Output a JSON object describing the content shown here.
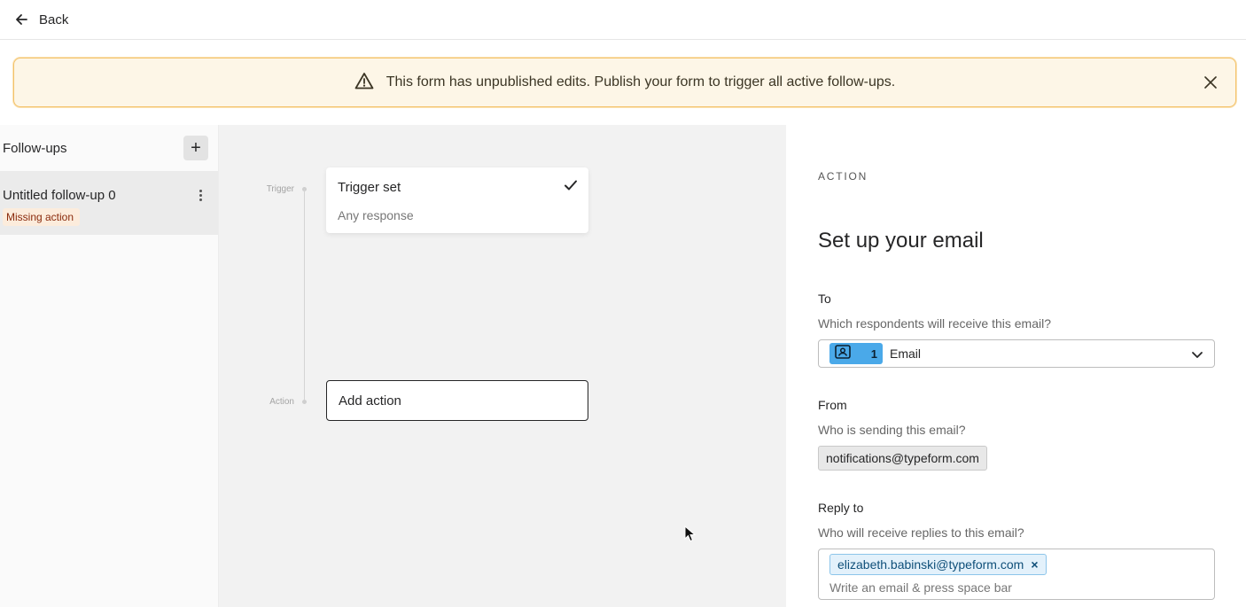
{
  "topbar": {
    "back_label": "Back"
  },
  "banner": {
    "message": "This form has unpublished edits. Publish your form to trigger all active follow-ups."
  },
  "sidebar": {
    "title": "Follow-ups",
    "add_label": "+",
    "items": [
      {
        "name": "Untitled follow-up 0",
        "badge": "Missing action"
      }
    ]
  },
  "canvas": {
    "trigger_label": "Trigger",
    "action_label": "Action",
    "trigger_card": {
      "title": "Trigger set",
      "subtitle": "Any response"
    },
    "action_card": {
      "label": "Add action"
    }
  },
  "panel": {
    "eyebrow": "ACTION",
    "title": "Set up your email",
    "to": {
      "label": "To",
      "help": "Which respondents will receive this email?",
      "count": "1",
      "value": "Email"
    },
    "from": {
      "label": "From",
      "help": "Who is sending this email?",
      "value": "notifications@typeform.com"
    },
    "reply_to": {
      "label": "Reply to",
      "help": "Who will receive replies to this email?",
      "chip": "elizabeth.babinski@typeform.com",
      "chip_remove": "×",
      "placeholder": "Write an email & press space bar"
    }
  },
  "colors": {
    "banner_bg": "#fdf6e7",
    "banner_border": "#f3c26a",
    "badge_bg": "#fcecdc",
    "badge_text": "#8a2a0c",
    "accent_blue": "#4aa9e9",
    "chip_bg": "#e3f1fb"
  },
  "icons": [
    "arrow-left-icon",
    "warning-icon",
    "close-icon",
    "plus-icon",
    "more-vertical-icon",
    "check-icon",
    "contact-card-icon",
    "chevron-down-icon",
    "cursor-icon"
  ]
}
